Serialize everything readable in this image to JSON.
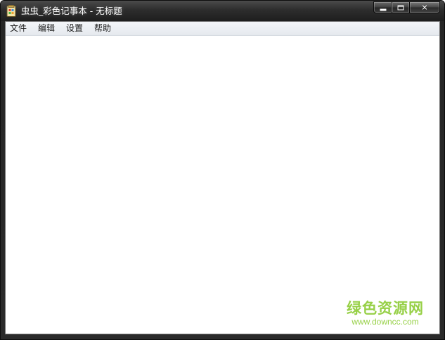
{
  "window": {
    "title": "虫虫_彩色记事本 - 无标题",
    "app_icon": "notepad-icon",
    "controls": {
      "minimize_icon": "minimize-icon",
      "maximize_icon": "maximize-icon",
      "close_glyph": "✕"
    }
  },
  "menu": {
    "items": [
      {
        "label": "文件"
      },
      {
        "label": "编辑"
      },
      {
        "label": "设置"
      },
      {
        "label": "帮助"
      }
    ]
  },
  "editor": {
    "value": ""
  },
  "watermark": {
    "brand": "绿色资源网",
    "url": "www.downcc.com",
    "color": "#8ccc34"
  },
  "colors": {
    "titlebar": "#2d2d2d",
    "menubar": "#e5e9ee",
    "editor_bg": "#ffffff"
  }
}
